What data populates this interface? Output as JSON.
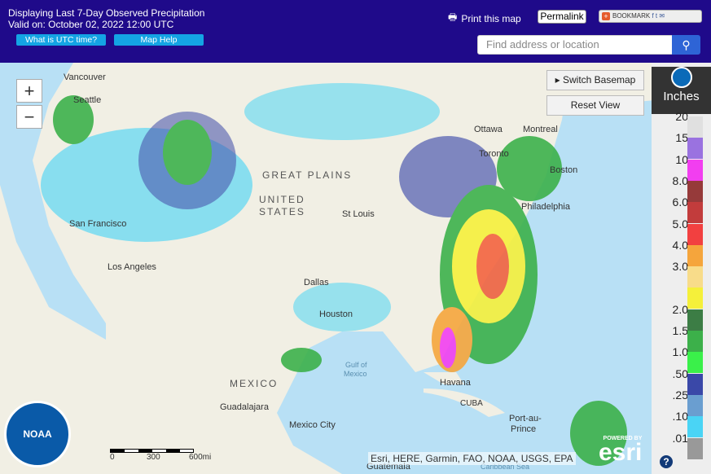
{
  "header": {
    "title": "Displaying Last 7-Day Observed Precipitation",
    "valid": "Valid on: October 02, 2022 12:00 UTC",
    "utc_button": "What is UTC time?",
    "help_button": "Map Help",
    "print": "Print this map",
    "permalink": "Permalink",
    "bookmark": "BOOKMARK",
    "search_placeholder": "Find address or location"
  },
  "map": {
    "zoom_in": "+",
    "zoom_out": "−",
    "switch_basemap": "Switch Basemap",
    "reset_view": "Reset View",
    "labels": [
      {
        "t": "Vancouver"
      },
      {
        "t": "Seattle"
      },
      {
        "t": "San Francisco"
      },
      {
        "t": "Los Angeles"
      },
      {
        "t": "GREAT PLAINS"
      },
      {
        "t": "UNITED"
      },
      {
        "t": "STATES"
      },
      {
        "t": "St Louis"
      },
      {
        "t": "Dallas"
      },
      {
        "t": "Houston"
      },
      {
        "t": "Gulf of"
      },
      {
        "t": "Mexico"
      },
      {
        "t": "MEXICO"
      },
      {
        "t": "Guadalajara"
      },
      {
        "t": "Mexico City"
      },
      {
        "t": "Havana"
      },
      {
        "t": "CUBA"
      },
      {
        "t": "Port-au-"
      },
      {
        "t": "Prince"
      },
      {
        "t": "Ottawa"
      },
      {
        "t": "Montreal"
      },
      {
        "t": "Toronto"
      },
      {
        "t": "Boston"
      },
      {
        "t": "Philadelphia"
      },
      {
        "t": "Guatemala"
      },
      {
        "t": "Caribbean Sea"
      }
    ],
    "scale": [
      "0",
      "300",
      "600mi"
    ],
    "attribution": "Esri, HERE, Garmin, FAO, NOAA, USGS, EPA",
    "esri": "esri",
    "powered_by": "POWERED BY"
  },
  "legend": {
    "unit": "Inches",
    "items": [
      {
        "label": "20",
        "color": "#e0e0e0"
      },
      {
        "label": "15",
        "color": "#9a72e0"
      },
      {
        "label": "10",
        "color": "#f23ef0"
      },
      {
        "label": "8.0",
        "color": "#963a3a"
      },
      {
        "label": "6.0",
        "color": "#c23c3c"
      },
      {
        "label": "5.0",
        "color": "#f24040"
      },
      {
        "label": "4.0",
        "color": "#f5a53c"
      },
      {
        "label": "3.0",
        "color": "#f8dc8a"
      },
      {
        "label": ".",
        "color": "#f5f03a"
      },
      {
        "label": "2.0",
        "color": "#3c7d45"
      },
      {
        "label": "1.5",
        "color": "#3cb04a"
      },
      {
        "label": "1.0",
        "color": "#3af04a"
      },
      {
        "label": ".50",
        "color": "#3a48a8"
      },
      {
        "label": ".25",
        "color": "#6a9ed0"
      },
      {
        "label": ".10",
        "color": "#4ad4f5"
      },
      {
        "label": ".01",
        "color": "#999999"
      }
    ]
  }
}
